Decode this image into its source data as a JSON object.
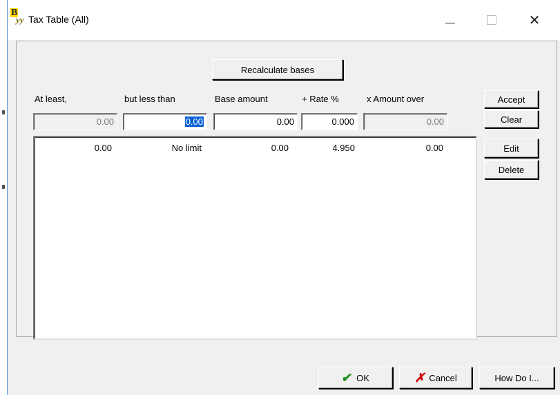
{
  "window": {
    "title": "Tax Table (All)",
    "icon_letters": {
      "b": "B",
      "yy": "yy"
    },
    "controls": {
      "minimize": "—",
      "maximize": "□",
      "close": "✕"
    }
  },
  "toolbar": {
    "recalculate_label": "Recalculate bases"
  },
  "columns": {
    "at_least": "At least,",
    "less_than": "but less than",
    "base_amount": "Base amount",
    "rate": "+ Rate %",
    "amount_over": "x Amount over"
  },
  "entry": {
    "at_least": "0.00",
    "less_than": "0.00",
    "base_amount": "0.00",
    "rate": "0.000",
    "amount_over": "0.00"
  },
  "side_buttons": {
    "accept": "Accept",
    "clear": "Clear",
    "edit": "Edit",
    "delete": "Delete"
  },
  "rows": [
    {
      "at_least": "0.00",
      "less_than": "No limit",
      "base_amount": "0.00",
      "rate": "4.950",
      "amount_over": "0.00"
    }
  ],
  "footer": {
    "ok": "OK",
    "cancel": "Cancel",
    "how_do_i": "How Do I..."
  },
  "icons": {
    "ok_icon": "check-icon",
    "cancel_icon": "x-icon"
  },
  "colors": {
    "selection": "#0a64d6",
    "ok_check": "#1f8f1f",
    "cancel_x": "#cc0000"
  }
}
